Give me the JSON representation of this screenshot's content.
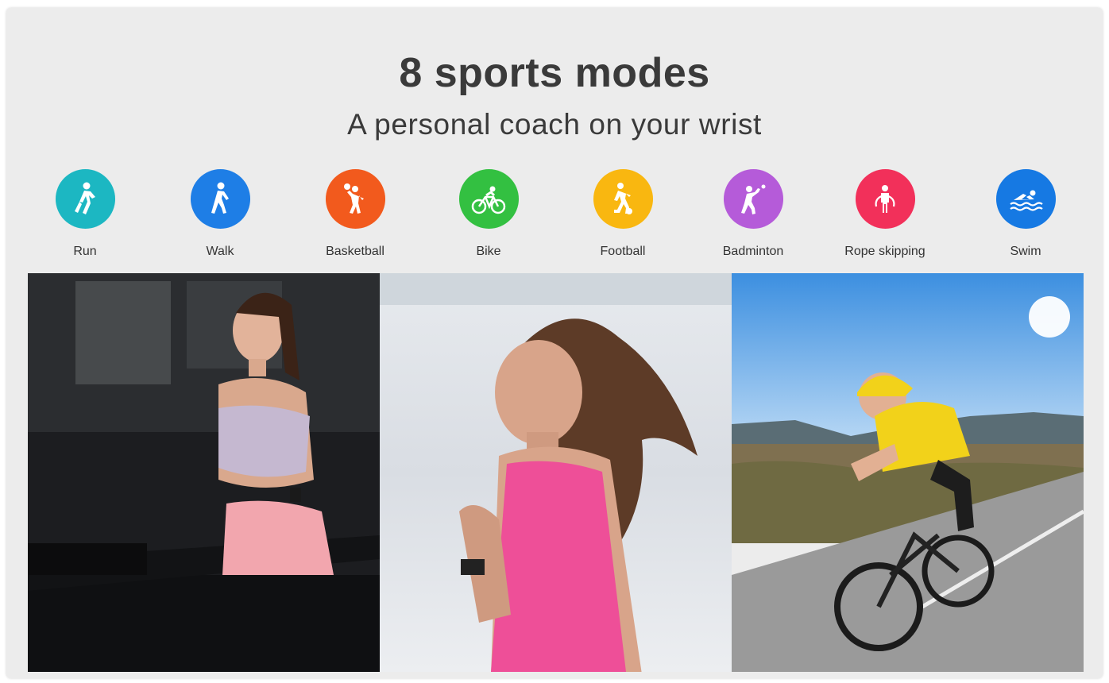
{
  "header": {
    "title": "8 sports modes",
    "subtitle": "A personal coach on your wrist"
  },
  "modes": [
    {
      "label": "Run",
      "color": "#1cb7c2",
      "icon": "run-icon"
    },
    {
      "label": "Walk",
      "color": "#1e7ee6",
      "icon": "walk-icon"
    },
    {
      "label": "Basketball",
      "color": "#f25a1d",
      "icon": "basketball-icon"
    },
    {
      "label": "Bike",
      "color": "#33c041",
      "icon": "bike-icon"
    },
    {
      "label": "Football",
      "color": "#f9b710",
      "icon": "football-icon"
    },
    {
      "label": "Badminton",
      "color": "#b55bd9",
      "icon": "badminton-icon"
    },
    {
      "label": "Rope skipping",
      "color": "#f2305a",
      "icon": "rope-skipping-icon"
    },
    {
      "label": "Swim",
      "color": "#1679e3",
      "icon": "swim-icon"
    }
  ],
  "photos": [
    {
      "subject": "treadmill-runner-photo"
    },
    {
      "subject": "outdoor-runner-photo"
    },
    {
      "subject": "road-cyclist-photo"
    }
  ]
}
